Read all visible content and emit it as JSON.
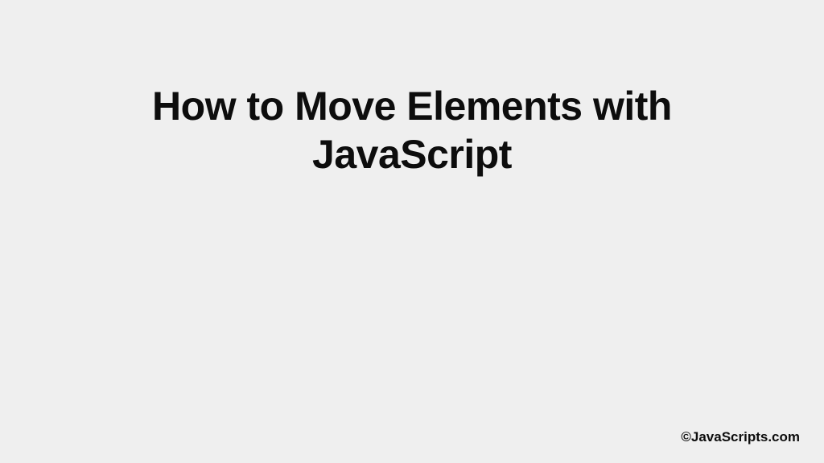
{
  "main": {
    "title": "How to Move Elements with JavaScript"
  },
  "footer": {
    "attribution": "©JavaScripts.com"
  }
}
